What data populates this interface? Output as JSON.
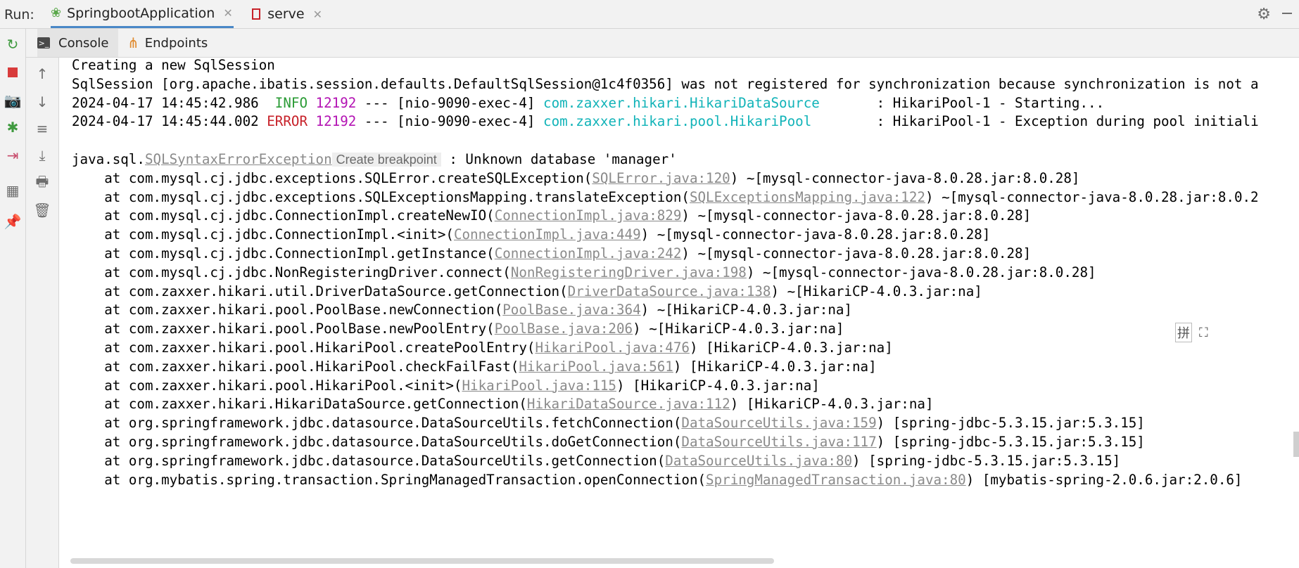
{
  "run_label": "Run:",
  "tabs": [
    {
      "label": "SpringbootApplication",
      "active": true
    },
    {
      "label": "serve",
      "active": false
    }
  ],
  "subtabs": [
    {
      "label": "Console",
      "active": true
    },
    {
      "label": "Endpoints",
      "active": false
    }
  ],
  "lines": [
    {
      "segments": [
        {
          "t": "Creating a new SqlSession",
          "c": ""
        }
      ]
    },
    {
      "segments": [
        {
          "t": "SqlSession [org.apache.ibatis.session.defaults.DefaultSqlSession@1c4f0356] was not registered for synchronization because synchronization is not a",
          "c": ""
        }
      ]
    },
    {
      "segments": [
        {
          "t": "2024-04-17 14:45:42.986  ",
          "c": ""
        },
        {
          "t": "INFO",
          "c": "info"
        },
        {
          "t": " ",
          "c": ""
        },
        {
          "t": "12192",
          "c": "pid"
        },
        {
          "t": " --- [nio-9090-exec-4] ",
          "c": ""
        },
        {
          "t": "com.zaxxer.hikari.HikariDataSource",
          "c": "cls"
        },
        {
          "t": "       : HikariPool-1 - Starting...",
          "c": ""
        }
      ]
    },
    {
      "segments": [
        {
          "t": "2024-04-17 14:45:44.002 ",
          "c": ""
        },
        {
          "t": "ERROR",
          "c": "err"
        },
        {
          "t": " ",
          "c": ""
        },
        {
          "t": "12192",
          "c": "pid"
        },
        {
          "t": " --- [nio-9090-exec-4] ",
          "c": ""
        },
        {
          "t": "com.zaxxer.hikari.pool.HikariPool",
          "c": "cls"
        },
        {
          "t": "        : HikariPool-1 - Exception during pool initiali",
          "c": ""
        }
      ]
    },
    {
      "segments": [
        {
          "t": "",
          "c": ""
        }
      ]
    },
    {
      "segments": [
        {
          "t": "java.sql.",
          "c": ""
        },
        {
          "t": "SQLSyntaxErrorException",
          "c": "link"
        },
        {
          "t": "Create breakpoint",
          "c": "bp"
        },
        {
          "t": " : Unknown database 'manager'",
          "c": ""
        }
      ]
    },
    {
      "segments": [
        {
          "t": "    at com.mysql.cj.jdbc.exceptions.SQLError.createSQLException(",
          "c": ""
        },
        {
          "t": "SQLError.java:120",
          "c": "link"
        },
        {
          "t": ") ~[mysql-connector-java-8.0.28.jar:8.0.28]",
          "c": ""
        }
      ]
    },
    {
      "segments": [
        {
          "t": "    at com.mysql.cj.jdbc.exceptions.SQLExceptionsMapping.translateException(",
          "c": ""
        },
        {
          "t": "SQLExceptionsMapping.java:122",
          "c": "link"
        },
        {
          "t": ") ~[mysql-connector-java-8.0.28.jar:8.0.2",
          "c": ""
        }
      ]
    },
    {
      "segments": [
        {
          "t": "    at com.mysql.cj.jdbc.ConnectionImpl.createNewIO(",
          "c": ""
        },
        {
          "t": "ConnectionImpl.java:829",
          "c": "link"
        },
        {
          "t": ") ~[mysql-connector-java-8.0.28.jar:8.0.28]",
          "c": ""
        }
      ]
    },
    {
      "segments": [
        {
          "t": "    at com.mysql.cj.jdbc.ConnectionImpl.<init>(",
          "c": ""
        },
        {
          "t": "ConnectionImpl.java:449",
          "c": "link"
        },
        {
          "t": ") ~[mysql-connector-java-8.0.28.jar:8.0.28]",
          "c": ""
        }
      ]
    },
    {
      "segments": [
        {
          "t": "    at com.mysql.cj.jdbc.ConnectionImpl.getInstance(",
          "c": ""
        },
        {
          "t": "ConnectionImpl.java:242",
          "c": "link"
        },
        {
          "t": ") ~[mysql-connector-java-8.0.28.jar:8.0.28]",
          "c": ""
        }
      ]
    },
    {
      "segments": [
        {
          "t": "    at com.mysql.cj.jdbc.NonRegisteringDriver.connect(",
          "c": ""
        },
        {
          "t": "NonRegisteringDriver.java:198",
          "c": "link"
        },
        {
          "t": ") ~[mysql-connector-java-8.0.28.jar:8.0.28]",
          "c": ""
        }
      ]
    },
    {
      "segments": [
        {
          "t": "    at com.zaxxer.hikari.util.DriverDataSource.getConnection(",
          "c": ""
        },
        {
          "t": "DriverDataSource.java:138",
          "c": "link"
        },
        {
          "t": ") ~[HikariCP-4.0.3.jar:na]",
          "c": ""
        }
      ]
    },
    {
      "segments": [
        {
          "t": "    at com.zaxxer.hikari.pool.PoolBase.newConnection(",
          "c": ""
        },
        {
          "t": "PoolBase.java:364",
          "c": "link"
        },
        {
          "t": ") ~[HikariCP-4.0.3.jar:na]",
          "c": ""
        }
      ]
    },
    {
      "segments": [
        {
          "t": "    at com.zaxxer.hikari.pool.PoolBase.newPoolEntry(",
          "c": ""
        },
        {
          "t": "PoolBase.java:206",
          "c": "link"
        },
        {
          "t": ") ~[HikariCP-4.0.3.jar:na]",
          "c": ""
        }
      ]
    },
    {
      "segments": [
        {
          "t": "    at com.zaxxer.hikari.pool.HikariPool.createPoolEntry(",
          "c": ""
        },
        {
          "t": "HikariPool.java:476",
          "c": "link"
        },
        {
          "t": ") [HikariCP-4.0.3.jar:na]",
          "c": ""
        }
      ]
    },
    {
      "segments": [
        {
          "t": "    at com.zaxxer.hikari.pool.HikariPool.checkFailFast(",
          "c": ""
        },
        {
          "t": "HikariPool.java:561",
          "c": "link"
        },
        {
          "t": ") [HikariCP-4.0.3.jar:na]",
          "c": ""
        }
      ]
    },
    {
      "segments": [
        {
          "t": "    at com.zaxxer.hikari.pool.HikariPool.<init>(",
          "c": ""
        },
        {
          "t": "HikariPool.java:115",
          "c": "link"
        },
        {
          "t": ") [HikariCP-4.0.3.jar:na]",
          "c": ""
        }
      ]
    },
    {
      "segments": [
        {
          "t": "    at com.zaxxer.hikari.HikariDataSource.getConnection(",
          "c": ""
        },
        {
          "t": "HikariDataSource.java:112",
          "c": "link"
        },
        {
          "t": ") [HikariCP-4.0.3.jar:na]",
          "c": ""
        }
      ]
    },
    {
      "segments": [
        {
          "t": "    at org.springframework.jdbc.datasource.DataSourceUtils.fetchConnection(",
          "c": ""
        },
        {
          "t": "DataSourceUtils.java:159",
          "c": "link"
        },
        {
          "t": ") [spring-jdbc-5.3.15.jar:5.3.15]",
          "c": ""
        }
      ]
    },
    {
      "segments": [
        {
          "t": "    at org.springframework.jdbc.datasource.DataSourceUtils.doGetConnection(",
          "c": ""
        },
        {
          "t": "DataSourceUtils.java:117",
          "c": "link"
        },
        {
          "t": ") [spring-jdbc-5.3.15.jar:5.3.15]",
          "c": ""
        }
      ]
    },
    {
      "segments": [
        {
          "t": "    at org.springframework.jdbc.datasource.DataSourceUtils.getConnection(",
          "c": ""
        },
        {
          "t": "DataSourceUtils.java:80",
          "c": "link"
        },
        {
          "t": ") [spring-jdbc-5.3.15.jar:5.3.15]",
          "c": ""
        }
      ]
    },
    {
      "segments": [
        {
          "t": "    at org.mybatis.spring.transaction.SpringManagedTransaction.openConnection(",
          "c": ""
        },
        {
          "t": "SpringManagedTransaction.java:80",
          "c": "link"
        },
        {
          "t": ") [mybatis-spring-2.0.6.jar:2.0.6]",
          "c": ""
        }
      ]
    }
  ],
  "ime": {
    "pinyin": "拼",
    "expand": "⛶"
  },
  "icons": {
    "rerun": "rerun-icon",
    "stop": "stop-icon",
    "snapshot": "camera-icon",
    "debug": "debug-icon",
    "exit": "exit-icon",
    "layout": "layout-icon",
    "pin": "pin-icon",
    "up": "arrow-up-icon",
    "down": "arrow-down-icon",
    "wrap": "soft-wrap-icon",
    "scroll": "scroll-to-end-icon",
    "print": "print-icon",
    "trash": "trash-icon",
    "settings": "gear-icon"
  },
  "colors": {
    "info": "#2a9b35",
    "error": "#c7222a",
    "pid": "#b313b3",
    "logger": "#11b3b8",
    "link": "#8a8a8a",
    "tab_underline": "#4a88c7"
  }
}
